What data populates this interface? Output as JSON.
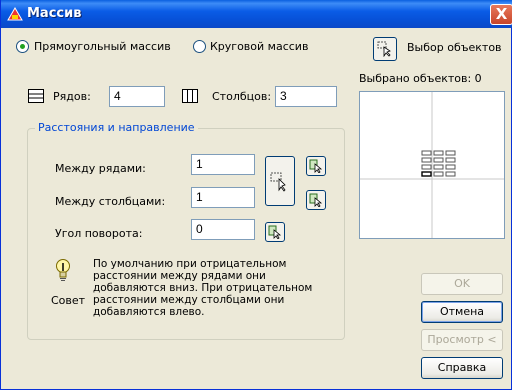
{
  "title": "Массив",
  "close_glyph": "X",
  "mode": {
    "rectangular_label": "Прямоугольный массив",
    "rectangular_selected": true,
    "polar_label": "Круговой массив",
    "polar_selected": false
  },
  "select_objects": {
    "label": "Выбор объектов",
    "count_label": "Выбрано объектов: 0"
  },
  "rows": {
    "label": "Рядов:",
    "value": "4"
  },
  "columns": {
    "label": "Столбцов:",
    "value": "3"
  },
  "group": {
    "title": "Расстояния и направление",
    "row_offset": {
      "label": "Между рядами:",
      "value": "1"
    },
    "column_offset": {
      "label": "Между столбцами:",
      "value": "1"
    },
    "angle": {
      "label": "Угол поворота:",
      "value": "0"
    }
  },
  "tip": {
    "caption": "Совет",
    "text": "По умолчанию при отрицательном расстоянии между рядами они добавляются вниз. При отрицательном расстоянии между столбцами они добавляются влево."
  },
  "buttons": {
    "ok": "OK",
    "cancel": "Отмена",
    "preview": "Просмотр <",
    "help": "Справка"
  },
  "icons": {
    "app": "autocad-array-icon",
    "rows": "rows-icon",
    "columns": "columns-icon",
    "pick": "pick-point-icon",
    "pick_both": "pick-both-offsets-icon",
    "tip": "lightbulb-icon",
    "select": "select-objects-icon"
  },
  "colors": {
    "titlebar": "#0a5ce6",
    "dialog_bg": "#ece9d8",
    "group_title": "#0046d5",
    "radio_dot": "#21a121",
    "close": "#d3532f"
  }
}
